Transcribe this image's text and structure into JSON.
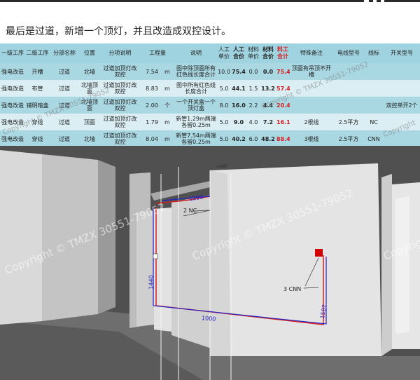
{
  "caption": "最后是过道，新增一个顶灯，并且改造成双控设计。",
  "table": {
    "headers": [
      "一级工序",
      "二级工序",
      "分部名称",
      "位置",
      "分项说明",
      "工程量",
      "",
      "说明",
      "人工单价",
      "人工合价",
      "材料单价",
      "材料合价",
      "料工合计",
      "特殊备注",
      "电线型号",
      "线标",
      "开关型号"
    ],
    "rows": [
      [
        "强电改造",
        "开槽",
        "过道",
        "北墙",
        "过道加顶灯改双控",
        "7.54",
        "m",
        "图中除顶面所有红色线长度合计",
        "10.0",
        "75.4",
        "0.0",
        "0.0",
        "75.4",
        "顶面有吊顶不开槽",
        "",
        "",
        ""
      ],
      [
        "强电改造",
        "布管",
        "过道",
        "北墙顶面",
        "过道加顶灯改双控",
        "8.83",
        "m",
        "图中所有红色线长度合计",
        "5.0",
        "44.1",
        "1.5",
        "13.2",
        "57.4",
        "",
        "",
        "",
        ""
      ],
      [
        "强电改造",
        "铺明暗盒",
        "过道",
        "北墙顶面",
        "过道加顶灯改双控",
        "2.00",
        "个",
        "一个开关盒一个顶灯盒",
        "8.0",
        "16.0",
        "2.2",
        "4.4",
        "20.4",
        "",
        "",
        "",
        "双控单开2个"
      ],
      [
        "强电改造",
        "穿线",
        "过道",
        "顶面",
        "过道加顶灯改双控",
        "1.79",
        "m",
        "新管1.29m两端各留0.25m",
        "5.0",
        "9.0",
        "4.0",
        "7.2",
        "16.1",
        "2根线",
        "2.5平方",
        "NC",
        ""
      ],
      [
        "强电改造",
        "穿线",
        "过道",
        "北墙",
        "过道加顶灯改双控",
        "8.04",
        "m",
        "新管7.54m两端各留0.25m",
        "5.0",
        "40.2",
        "6.0",
        "48.2",
        "88.4",
        "3根线",
        "2.5平方",
        "CNN",
        ""
      ]
    ]
  },
  "scene": {
    "labels": {
      "top_dim": "1290",
      "callout_top": "2 NC",
      "callout_mid": "3 CNN",
      "dim_left": "1440",
      "dim_right": "1587",
      "dim_bottom": "1000"
    },
    "watermark": "Copyright © TMZX 30551-79052",
    "watermark_short": "Copyright",
    "colors": {
      "red_line": "#d62020",
      "blue_line": "#2323c8",
      "box_red": "#d40000"
    }
  }
}
